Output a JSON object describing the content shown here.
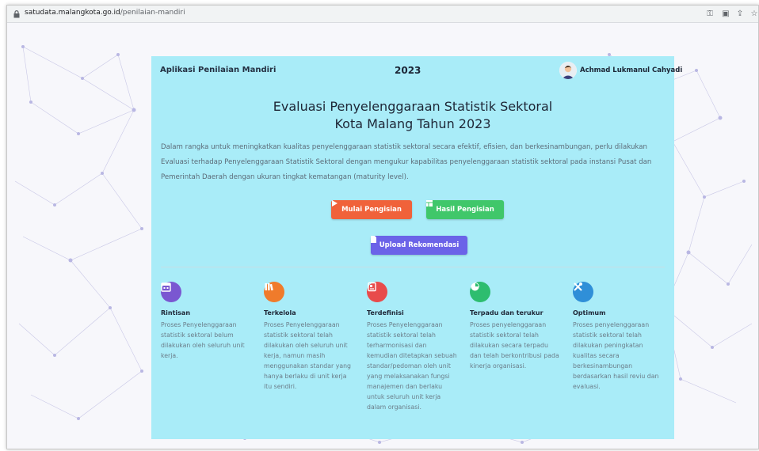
{
  "browser": {
    "url_host": "satudata.malangkota.go.id",
    "url_path": "/penilaian-mandiri",
    "icons": [
      "lock-icon",
      "key-icon",
      "translate-icon",
      "share-icon",
      "star-icon"
    ]
  },
  "header": {
    "app_title": "Aplikasi Penilaian Mandiri",
    "year": "2023",
    "user_name": "Achmad Lukmanul Cahyadi"
  },
  "main": {
    "title_line1": "Evaluasi Penyelenggaraan Statistik Sektoral",
    "title_line2": "Kota Malang Tahun 2023",
    "intro": "Dalam rangka untuk meningkatkan kualitas penyelenggaraan statistik sektoral secara efektif, efisien, dan berkesinambungan, perlu dilakukan Evaluasi terhadap Penyelenggaraan Statistik Sektoral dengan mengukur kapabilitas penyelenggaraan statistik sektoral pada instansi Pusat dan Pemerintah Daerah dengan ukuran tingkat kematangan (maturity level).",
    "buttons": {
      "mulai": "Mulai Pengisian",
      "hasil": "Hasil Pengisian",
      "upload": "Upload Rekomendasi"
    },
    "levels": [
      {
        "icon": "calendar-icon",
        "color": "#7a57d1",
        "title": "Rintisan",
        "desc": "Proses Penyelenggaraan statistik sektoral belum dilakukan oleh seluruh unit kerja."
      },
      {
        "icon": "books-icon",
        "color": "#f07b2b",
        "title": "Terkelola",
        "desc": "Proses Penyelenggaraan statistik sektoral telah dilakukan oleh seluruh unit kerja, namun masih menggunakan standar yang hanya berlaku di unit kerja itu sendiri."
      },
      {
        "icon": "document-icon",
        "color": "#e84b4b",
        "title": "Terdefinisi",
        "desc": "Proses Penyelenggaraan statistik sektoral telah terharmonisasi dan kemudian ditetapkan sebuah standar/pedoman oleh unit yang melaksanakan fungsi manajemen dan berlaku untuk seluruh unit kerja dalam organisasi."
      },
      {
        "icon": "pie-chart-icon",
        "color": "#2dbd6f",
        "title": "Terpadu dan terukur",
        "desc": "Proses penyelenggaraan statistik sektoral telah dilakukan secara terpadu dan telah berkontribusi pada kinerja organisasi."
      },
      {
        "icon": "tools-icon",
        "color": "#2f8fd8",
        "title": "Optimum",
        "desc": "Proses penyelenggaraan statistik sektoral telah dilakukan peningkatan kualitas secara berkesinambungan berdasarkan hasil reviu dan evaluasi."
      }
    ]
  }
}
